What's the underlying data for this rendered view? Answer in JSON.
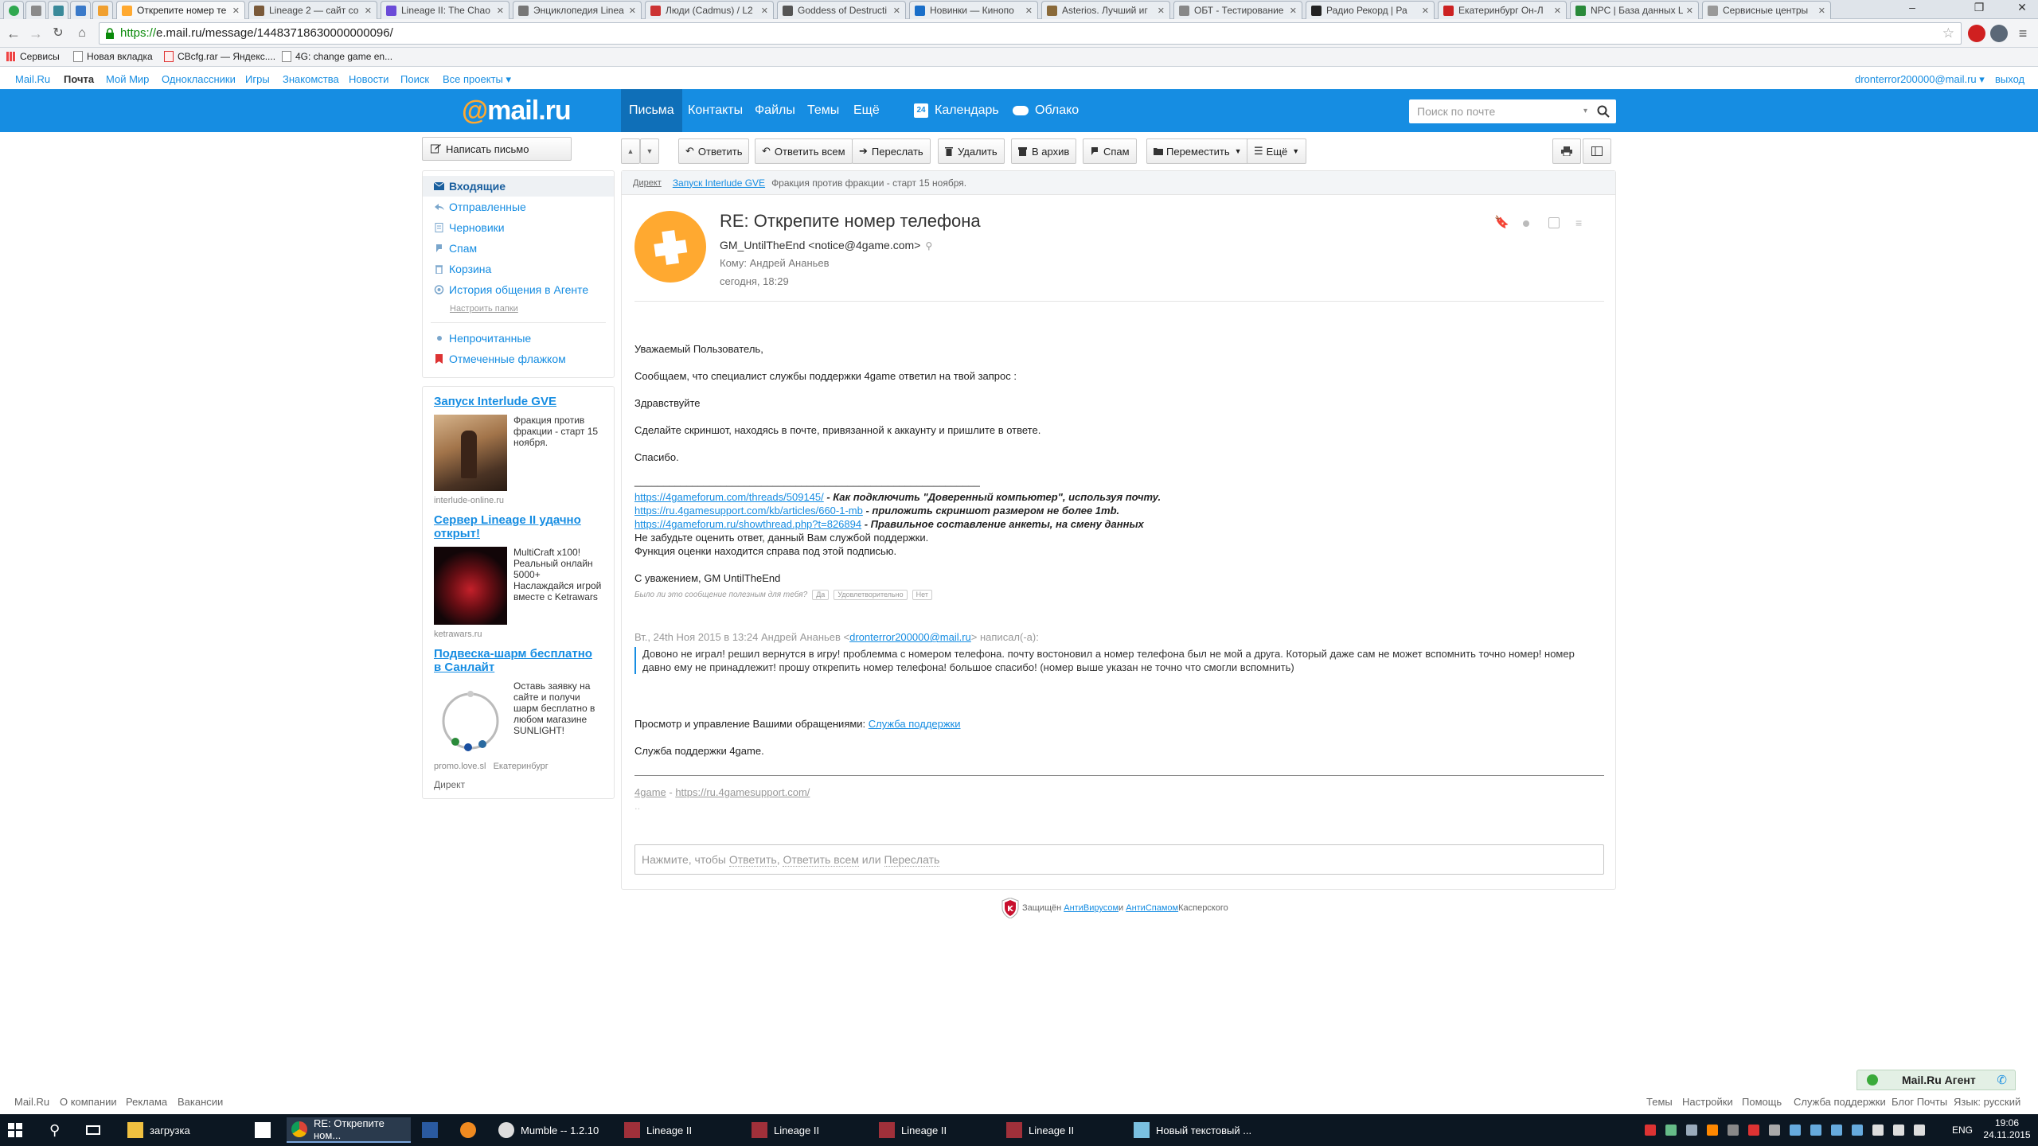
{
  "browser": {
    "tabs": [
      {
        "label": "Открепите номер те",
        "color": "#ffa930"
      },
      {
        "label": "Lineage 2 — сайт со",
        "color": "#7a5a3a"
      },
      {
        "label": "Lineage II: The Chao",
        "color": "#6b4bd8"
      },
      {
        "label": "Энциклопедия Linea",
        "color": "#777777"
      },
      {
        "label": "Люди (Cadmus) / L2",
        "color": "#cc3333"
      },
      {
        "label": "Goddess of Destructi",
        "color": "#555555"
      },
      {
        "label": "Новинки — Кинопо",
        "color": "#1a6fc9"
      },
      {
        "label": "Asterios. Лучший иг",
        "color": "#8a6a3a"
      },
      {
        "label": "ОБТ - Тестирование",
        "color": "#888888"
      },
      {
        "label": "Радио Рекорд | Ра",
        "color": "#222222"
      },
      {
        "label": "Екатеринбург Он-Л",
        "color": "#cc2222"
      },
      {
        "label": "NPC | База данных L",
        "color": "#2a8a3a"
      },
      {
        "label": "Сервисные центры",
        "color": "#999999"
      }
    ],
    "pinned_colors": [
      "#2fa84f",
      "#8a8a8a",
      "#3a8a9a",
      "#3a7ac9",
      "#f0a030"
    ],
    "url_scheme": "https://",
    "url_rest": "e.mail.ru/message/14483718630000000096/",
    "bookmarks": [
      "Сервисы",
      "Новая вкладка",
      "CBcfg.rar — Яндекс....",
      "4G: change game en..."
    ]
  },
  "topnav": {
    "items": [
      "Mail.Ru",
      "Почта",
      "Мой Мир",
      "Одноклассники",
      "Игры",
      "Знакомства",
      "Новости",
      "Поиск",
      "Все проекты ▾"
    ],
    "user": "dronterror200000@mail.ru ▾",
    "logout": "выход"
  },
  "header": {
    "logo_at": "@",
    "logo_text": "mail.ru",
    "nav": [
      "Письма",
      "Контакты",
      "Файлы",
      "Темы",
      "Ещё"
    ],
    "calendar": "Календарь",
    "calendar_day": "24",
    "cloud": "Облако",
    "search_placeholder": "Поиск по почте"
  },
  "left": {
    "compose": "Написать письмо",
    "folders": [
      "Входящие",
      "Отправленные",
      "Черновики",
      "Спам",
      "Корзина",
      "История общения в Агенте"
    ],
    "setup": "Настроить папки",
    "filters": [
      "Непрочитанные",
      "Отмеченные флажком"
    ],
    "ads": [
      {
        "title": "Запуск Interlude GVE",
        "text": "Фракция против фракции - старт 15 ноября.",
        "src": "interlude-online.ru"
      },
      {
        "title": "Сервер Lineage II удачно открыт!",
        "text": "MultiCraft x100! Реальный онлайн 5000+ Наслаждайся игрой вместе с Ketrawars",
        "src": "ketrawars.ru"
      },
      {
        "title": "Подвеска-шарм бесплатно в Санлайт",
        "text": "Оставь заявку на сайте и получи шарм бесплатно в любом магазине SUNLIGHT!",
        "src": "promo.love.sl",
        "src2": "Екатеринбург"
      }
    ],
    "direct": "Директ"
  },
  "toolbar": {
    "reply": "Ответить",
    "reply_all": "Ответить всем",
    "forward": "Переслать",
    "delete": "Удалить",
    "archive": "В архив",
    "spam": "Спам",
    "move": "Переместить",
    "more": "Ещё"
  },
  "message": {
    "ad_direct": "Директ",
    "ad_link": "Запуск Interlude GVE",
    "ad_text": "Фракция против фракции - старт 15 ноября.",
    "subject": "RE: Открепите номер телефона",
    "from": "GM_UntilTheEnd <notice@4game.com>",
    "to": "Кому: Андрей Ананьев",
    "date": "сегодня, 18:29",
    "greeting": "Уважаемый Пользователь,",
    "p1": "Сообщаем, что специалист службы поддержки 4game ответил на твой запрос :",
    "p2": "Здравствуйте",
    "p3": "Сделайте скриншот, находясь в почте, привязанной к аккаунту и пришлите в ответе.",
    "p4": "Спасибо.",
    "rule": "____________________________________________________________",
    "links": [
      {
        "url": "https://4gameforum.com/threads/509145/",
        "note": " - Как подключить \"Доверенный компьютер\", используя почту."
      },
      {
        "url": "https://ru.4gamesupport.com/kb/articles/660-1-mb",
        "note": " - приложить скриншот размером не более 1mb."
      },
      {
        "url": "https://4gameforum.ru/showthread.php?t=826894",
        "note": " - Правильное составление анкеты, на смену данных"
      }
    ],
    "note1": "Не забудьте оценить ответ, данный Вам службой поддержки.",
    "note2": "Функция оценки находится справа под этой подписью.",
    "regards": "С уважением,  GM UntilTheEnd",
    "helpful_q": "Было ли это сообщение полезным для тебя?",
    "helpful_opts": [
      "Да",
      "Удовлетворительно",
      "Нет"
    ],
    "quote_head_pre": "Вт., 24th Ноя 2015 в 13:24 Андрей Ананьев <",
    "quote_email": "dronterror200000@mail.ru",
    "quote_head_post": "> написал(-а):",
    "quote_text": "Довоно не играл! решил вернутся в игру! проблемма с номером телефона. почту востоновил а номер телефона был не мой а друга. Который даже сам не может вспомнить точно номер! номер давно ему не принадлежит! прошу открепить номер телефона! большое спасибо! (номер выше указан не точно что смогли вспомнить)",
    "manage_pre": "Просмотр и управление Вашими обращениями: ",
    "manage_link": "Служба поддержки",
    "signoff": "Служба поддержки 4game.",
    "foot_a": "4game",
    "foot_sep": " - ",
    "foot_b": "https://ru.4gamesupport.com/",
    "reply_pre": "Нажмите, чтобы ",
    "reply_a": "Ответить",
    "reply_sep1": ",  ",
    "reply_b": "Ответить всем",
    "reply_sep2": " или ",
    "reply_c": "Переслать"
  },
  "kaspersky": {
    "pre": "Защищён ",
    "a": "АнтиВирусом",
    "mid": " и ",
    "b": "АнтиСпамом",
    "post": " Касперского"
  },
  "footer": {
    "left": [
      "Mail.Ru",
      "О компании",
      "Реклама",
      "Вакансии"
    ],
    "right": [
      "Темы",
      "Настройки",
      "Помощь",
      "Служба поддержки",
      "Блог Почты",
      "Язык: русский"
    ],
    "agent": "Mail.Ru Агент"
  },
  "taskbar": {
    "items": [
      "загрузка",
      "RE: Открепите ном...",
      "",
      "",
      "Mumble -- 1.2.10",
      "Lineage II",
      "Lineage II",
      "Lineage II",
      "Lineage II",
      "Новый текстовый ..."
    ],
    "lang": "ENG",
    "time": "19:06",
    "date": "24.11.2015"
  }
}
